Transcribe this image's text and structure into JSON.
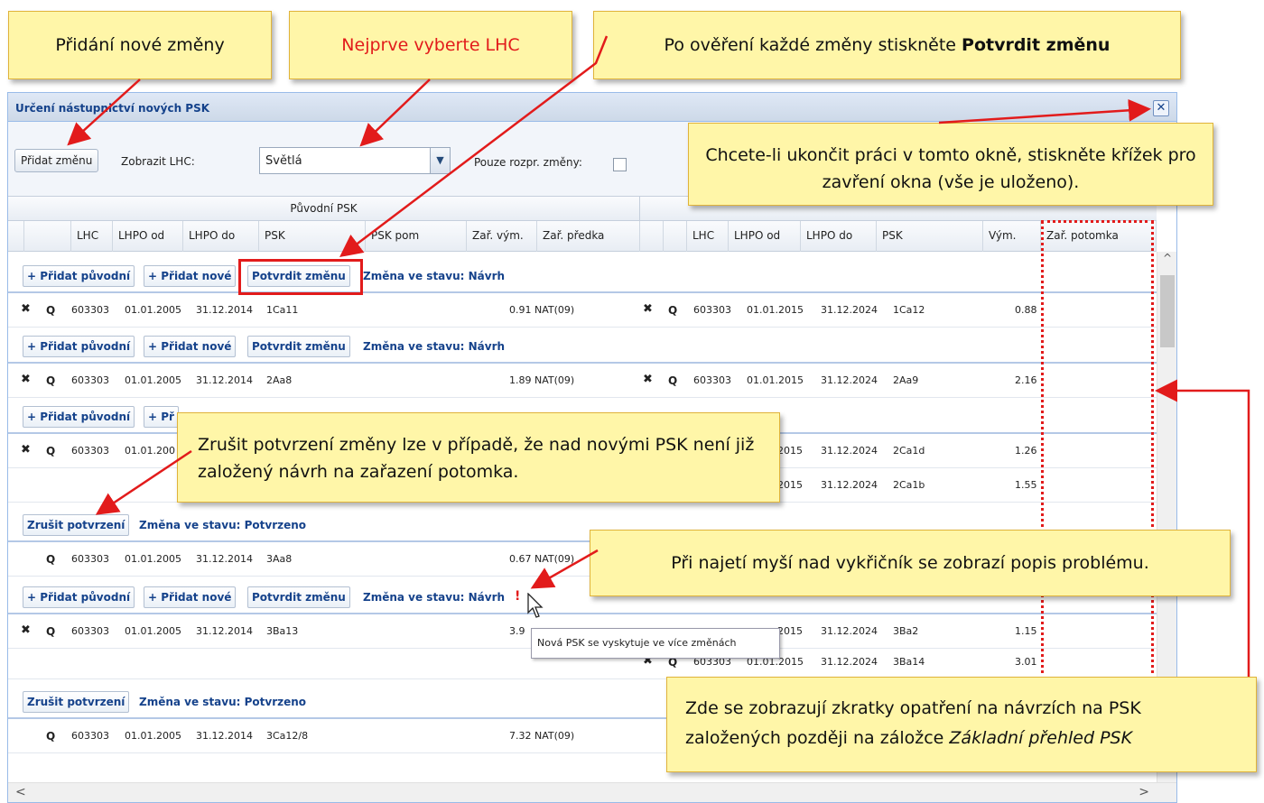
{
  "window": {
    "title": "Určení nástupnictví nových PSK",
    "close_glyph": "✕"
  },
  "toolbar": {
    "add_change": "Přidat změnu",
    "show_lhc_label": "Zobrazit LHC:",
    "lhc_value": "Světlá",
    "only_disputed_label": "Pouze rozpr. změny:"
  },
  "grid": {
    "group_original": "Původní PSK",
    "left_columns": [
      "LHC",
      "LHPO od",
      "LHPO do",
      "PSK",
      "PSK pom",
      "Zař. vým.",
      "Zař. předka"
    ],
    "right_columns": [
      "LHC",
      "LHPO od",
      "LHPO do",
      "PSK",
      "Vým.",
      "Zař. potomka"
    ],
    "buttons": {
      "add_original": "+ Přidat původní",
      "add_new": "+ Přidat nové",
      "confirm": "Potvrdit změnu",
      "cancel_confirm": "Zrušit potvrzení"
    },
    "states": {
      "draft": "Změna ve stavu: Návrh",
      "confirmed": "Změna ve stavu: Potvrzeno"
    },
    "rows": [
      {
        "l": [
          "603303",
          "01.01.2005",
          "31.12.2014",
          "1Ca11",
          "0.91",
          "NAT(09)"
        ],
        "r": [
          "603303",
          "01.01.2015",
          "31.12.2024",
          "1Ca12",
          "0.88"
        ]
      },
      {
        "l": [
          "603303",
          "01.01.2005",
          "31.12.2014",
          "2Aa8",
          "1.89",
          "NAT(09)"
        ],
        "r": [
          "603303",
          "01.01.2015",
          "31.12.2024",
          "2Aa9",
          "2.16"
        ]
      },
      {
        "l": [
          "603303",
          "01.01.200"
        ],
        "r": [
          "2015",
          "31.12.2024",
          "2Ca1d",
          "1.26"
        ]
      },
      {
        "r": [
          "2015",
          "31.12.2024",
          "2Ca1b",
          "1.55"
        ]
      },
      {
        "l": [
          "603303",
          "01.01.2005",
          "31.12.2014",
          "3Aa8",
          "0.67",
          "NAT(09)"
        ]
      },
      {
        "l": [
          "603303",
          "01.01.2005",
          "31.12.2014",
          "3Ba13",
          "3.9"
        ],
        "r": [
          "2015",
          "31.12.2024",
          "3Ba2",
          "1.15"
        ]
      },
      {
        "r": [
          "603303",
          "01.01.2015",
          "31.12.2024",
          "3Ba14",
          "3.01"
        ]
      },
      {
        "l": [
          "603303",
          "01.01.2005",
          "31.12.2014",
          "3Ca12/8",
          "7.32",
          "NAT(09)"
        ]
      }
    ],
    "partial_buttons": {
      "add_original": "+ Přidat původní",
      "add_new_partial": "+ Př"
    },
    "tooltip": "Nová PSK se vyskytuje ve více změnách",
    "warning_glyph": "!"
  },
  "callouts": {
    "add_new_change": "Přidání nové změny",
    "select_lhc_first": "Nejprve vyberte LHC",
    "confirm_each_prefix": "Po ověření každé změny stiskněte ",
    "confirm_each_bold": "Potvrdit změnu",
    "close_window": "Chcete-li ukončit práci v tomto okně, stiskněte křížek pro zavření okna (vše je uloženo).",
    "cancel_confirm": "Zrušit potvrzení změny lze v případě, že nad novými PSK není již založený návrh na zařazení potomka.",
    "hover_warning": "Při najetí myší nad vykřičník se zobrazí popis problému.",
    "shortcuts_prefix": "Zde se zobrazují zkratky opatření na návrzích na PSK založených později na záložce ",
    "shortcuts_italic": "Základní přehled PSK"
  },
  "colors": {
    "accent": "#15428b",
    "callout_bg": "#fff6a8",
    "highlight": "#e21b1b"
  }
}
